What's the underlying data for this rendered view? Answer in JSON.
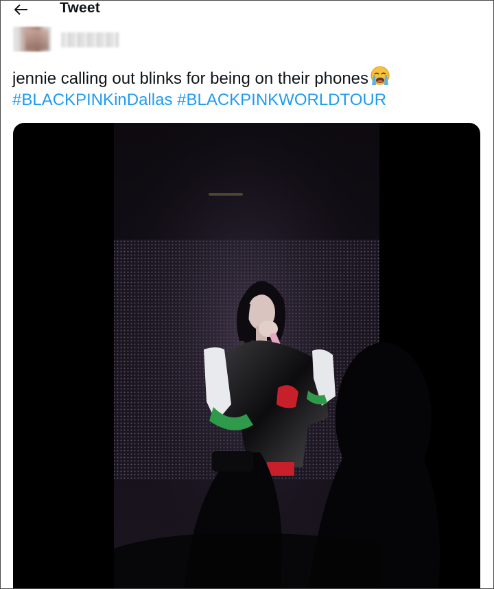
{
  "header": {
    "back_icon": "arrow-left-icon",
    "title": "Tweet"
  },
  "author": {
    "avatar": "blurred-avatar",
    "name_redacted": true
  },
  "tweet": {
    "text": "jennie calling out blinks for being on their phones",
    "emoji": "loudly-crying-face-emoji",
    "hashtags": [
      "#BLACKPINKinDallas",
      "#BLACKPINKWORLDTOUR"
    ],
    "hashtag_color": "#1d9bf0"
  },
  "media": {
    "type": "video-frame",
    "background": "#000000"
  }
}
